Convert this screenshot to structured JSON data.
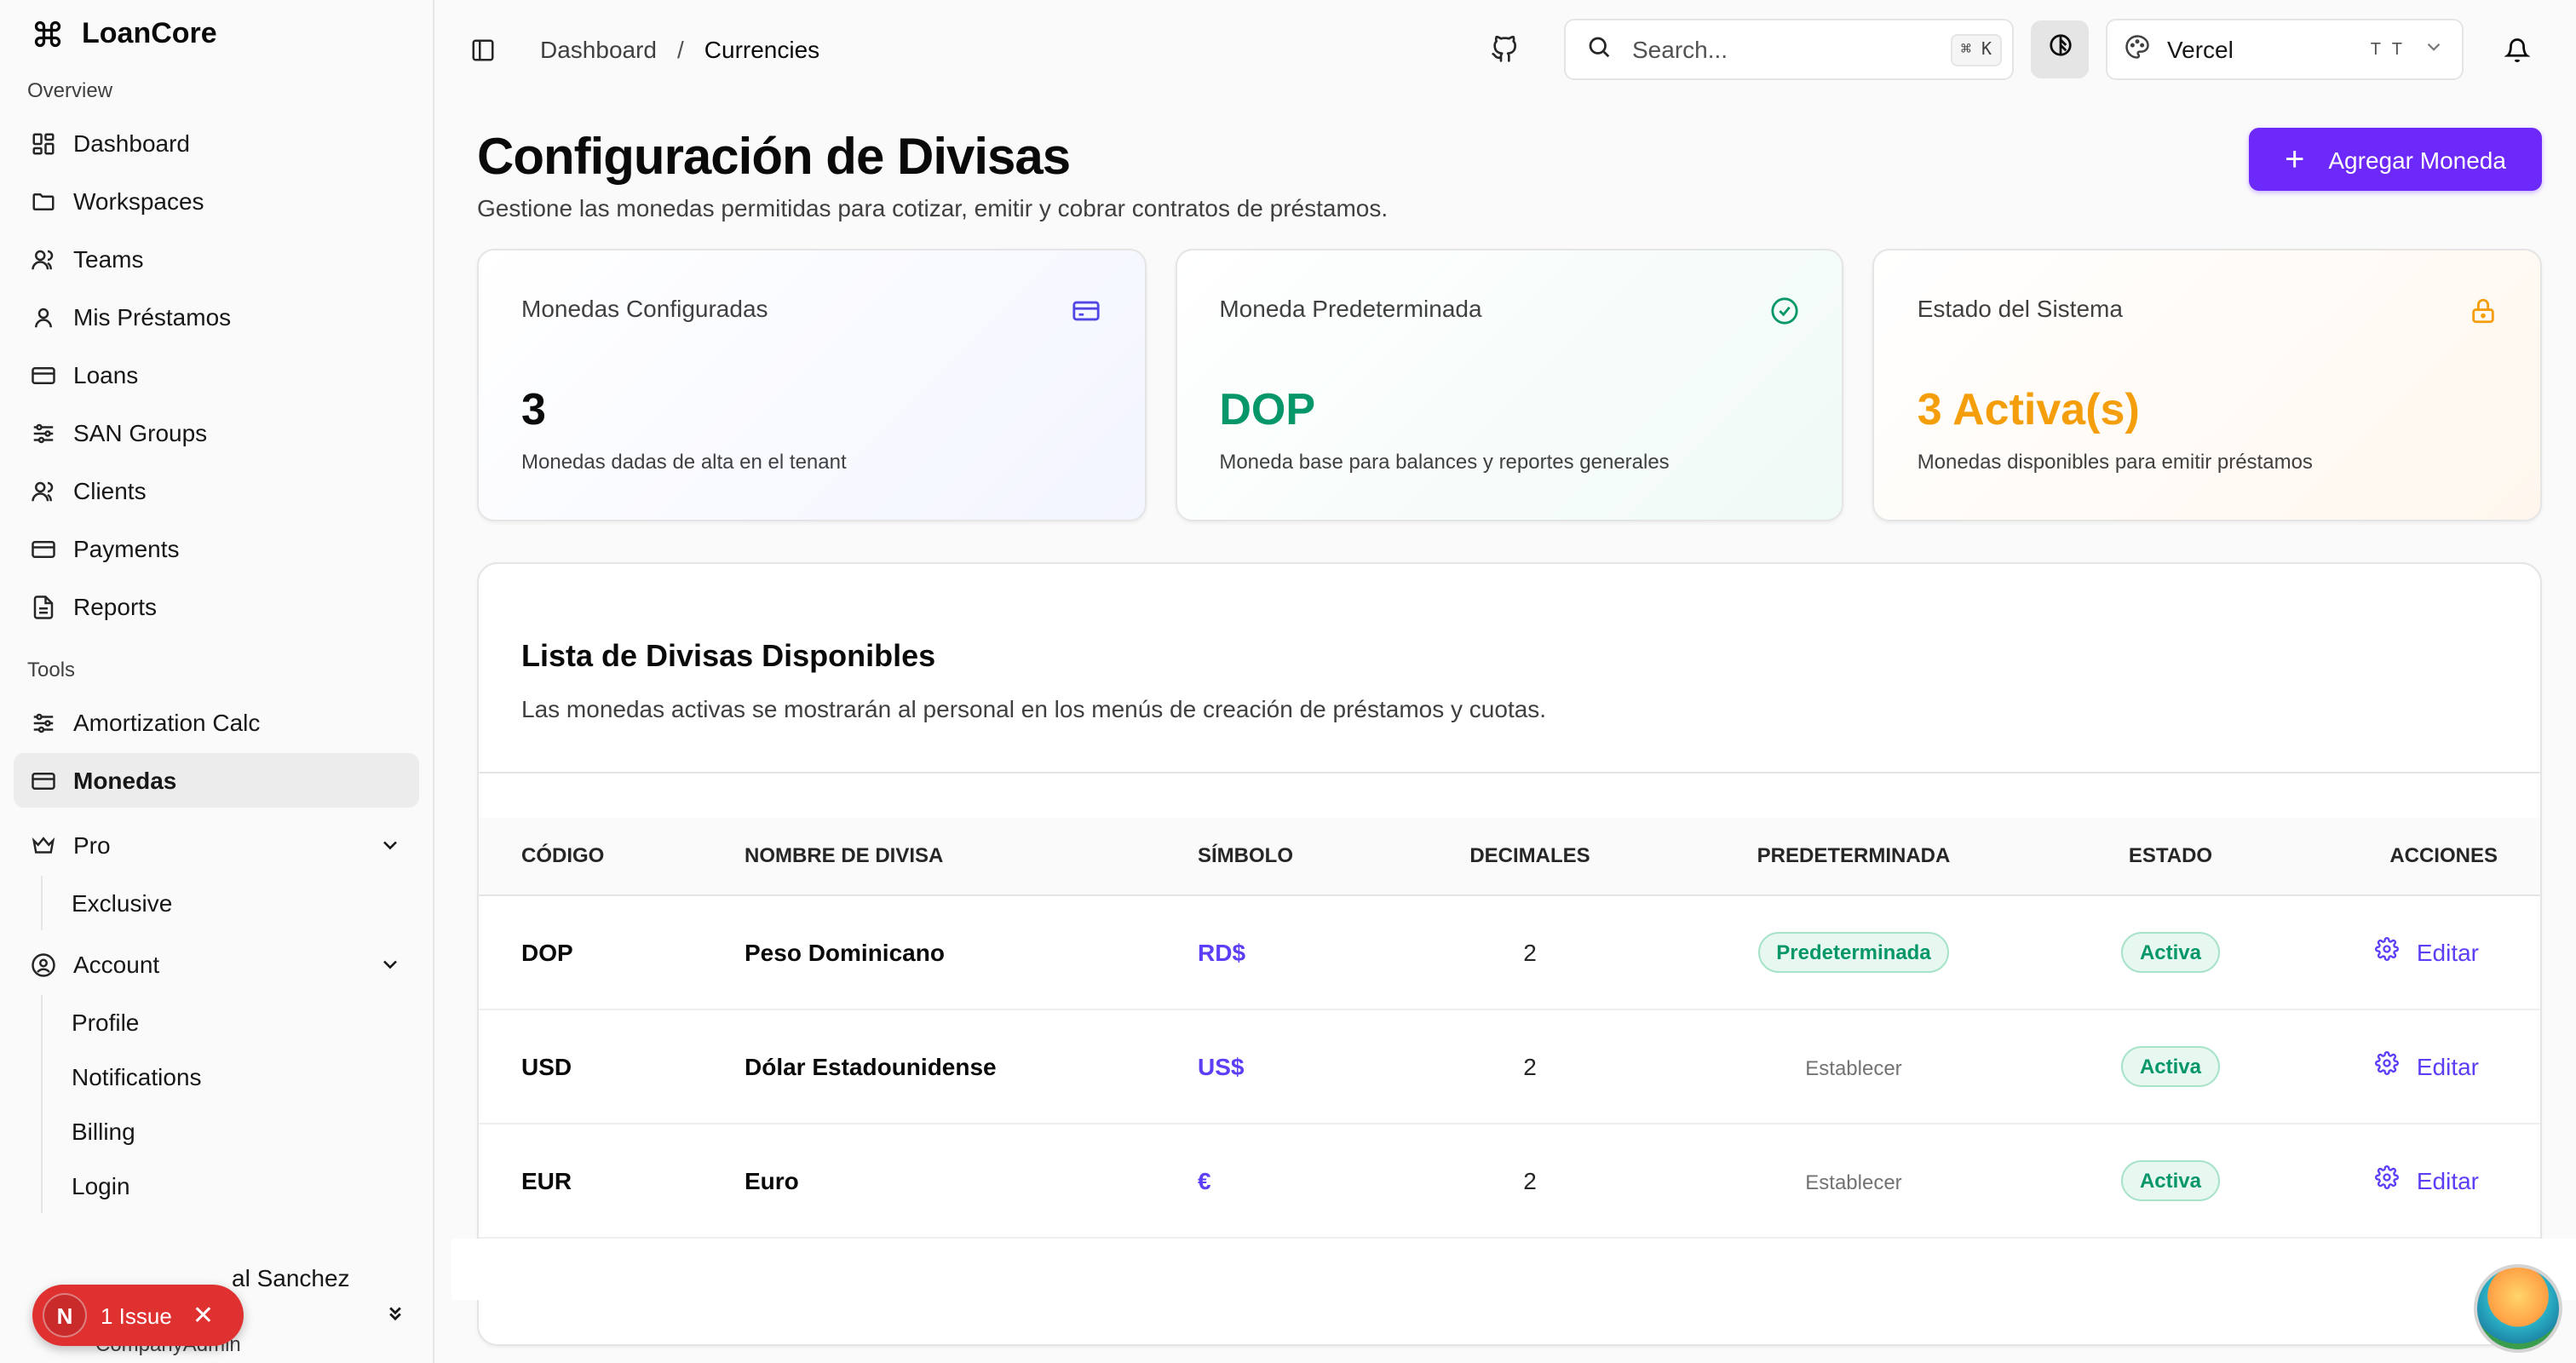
{
  "app": {
    "name": "LoanCore"
  },
  "sidebar": {
    "overview_label": "Overview",
    "overview_items": [
      {
        "label": "Dashboard",
        "icon": "dashboard-icon"
      },
      {
        "label": "Workspaces",
        "icon": "folder-icon"
      },
      {
        "label": "Teams",
        "icon": "users-icon"
      },
      {
        "label": "Mis Préstamos",
        "icon": "user-icon"
      },
      {
        "label": "Loans",
        "icon": "card-icon"
      },
      {
        "label": "SAN Groups",
        "icon": "sliders-icon"
      },
      {
        "label": "Clients",
        "icon": "users-icon"
      },
      {
        "label": "Payments",
        "icon": "card-icon"
      },
      {
        "label": "Reports",
        "icon": "file-icon"
      }
    ],
    "tools_label": "Tools",
    "tools_items": [
      {
        "label": "Amortization Calc",
        "icon": "sliders-icon"
      },
      {
        "label": "Monedas",
        "icon": "card-icon",
        "active": true
      }
    ],
    "pro": {
      "label": "Pro",
      "sub": [
        "Exclusive"
      ]
    },
    "account": {
      "label": "Account",
      "sub": [
        "Profile",
        "Notifications",
        "Billing",
        "Login"
      ]
    },
    "user": {
      "name_fragment": "al Sanchez",
      "role": "CompanyAdmin"
    },
    "issue": {
      "letter": "N",
      "label": "1 Issue"
    }
  },
  "topbar": {
    "breadcrumb": [
      "Dashboard",
      "Currencies"
    ],
    "search_placeholder": "Search...",
    "search_shortcut": "⌘ K",
    "team_name": "Vercel",
    "team_initials": "T T"
  },
  "page": {
    "title": "Configuración de Divisas",
    "subtitle": "Gestione las monedas permitidas para cotizar, emitir y cobrar contratos de préstamos.",
    "add_button": "Agregar Moneda"
  },
  "stats": [
    {
      "label": "Monedas Configuradas",
      "value": "3",
      "desc": "Monedas dadas de alta en el tenant",
      "icon": "credit-card-icon",
      "color": "#4f46e5"
    },
    {
      "label": "Moneda Predeterminada",
      "value": "DOP",
      "desc": "Moneda base para balances y reportes generales",
      "icon": "check-circle-icon",
      "color": "#059669"
    },
    {
      "label": "Estado del Sistema",
      "value": "3 Activa(s)",
      "desc": "Monedas disponibles para emitir préstamos",
      "icon": "lock-icon",
      "color": "#f59e0b"
    }
  ],
  "list": {
    "title": "Lista de Divisas Disponibles",
    "subtitle": "Las monedas activas se mostrarán al personal en los menús de creación de préstamos y cuotas.",
    "columns": [
      "CÓDIGO",
      "NOMBRE DE DIVISA",
      "SÍMBOLO",
      "DECIMALES",
      "PREDETERMINADA",
      "ESTADO",
      "ACCIONES"
    ],
    "rows": [
      {
        "code": "DOP",
        "name": "Peso Dominicano",
        "symbol": "RD$",
        "decimals": "2",
        "default": "Predeterminada",
        "is_default": true,
        "state": "Activa",
        "action": "Editar"
      },
      {
        "code": "USD",
        "name": "Dólar Estadounidense",
        "symbol": "US$",
        "decimals": "2",
        "default": "Establecer",
        "is_default": false,
        "state": "Activa",
        "action": "Editar"
      },
      {
        "code": "EUR",
        "name": "Euro",
        "symbol": "€",
        "decimals": "2",
        "default": "Establecer",
        "is_default": false,
        "state": "Activa",
        "action": "Editar"
      }
    ]
  }
}
